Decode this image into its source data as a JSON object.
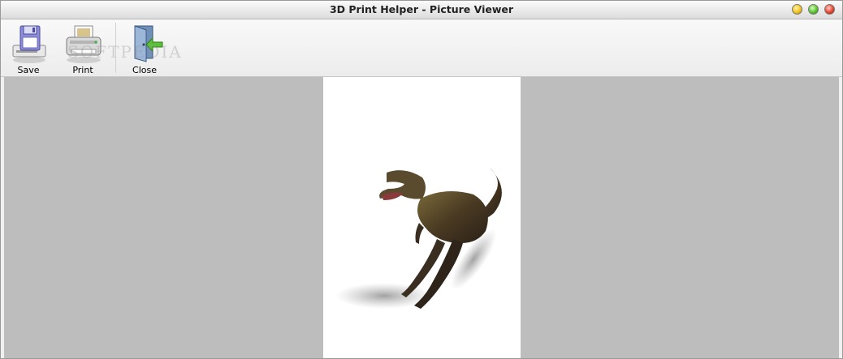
{
  "window": {
    "title": "3D Print Helper - Picture Viewer"
  },
  "toolbar": {
    "save_label": "Save",
    "print_label": "Print",
    "close_label": "Close"
  },
  "watermark": "SOFTPEDIA",
  "icons": {
    "save": "floppy-disk-icon",
    "print": "printer-icon",
    "close": "exit-door-icon"
  },
  "colors": {
    "viewer_background": "#bdbdbd",
    "page_background": "#ffffff"
  },
  "image": {
    "subject": "dinosaur-render"
  }
}
